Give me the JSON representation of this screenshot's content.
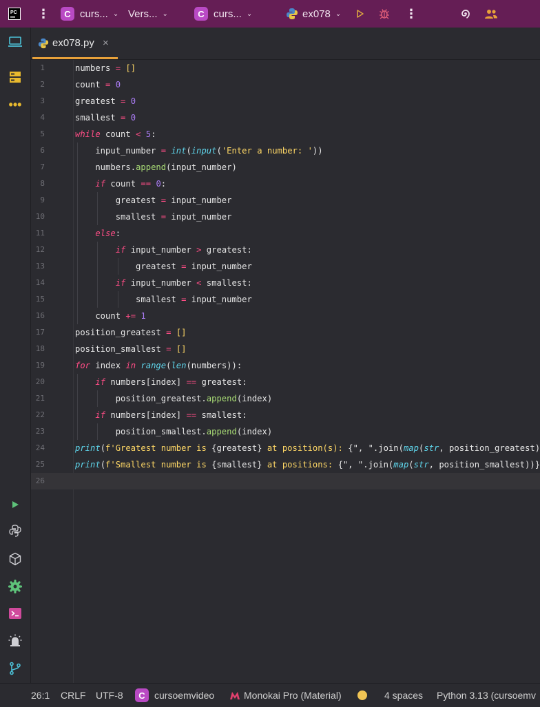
{
  "titlebar": {
    "project1": "curs...",
    "vcs": "Vers...",
    "project2": "curs...",
    "run_config": "ex078"
  },
  "tab": {
    "filename": "ex078.py",
    "close": "×"
  },
  "colors": {
    "titlebar": "#651e55",
    "accent": "#e8a13a",
    "badge": "#b94ac4"
  },
  "editor": {
    "current_line": 26,
    "lines": [
      {
        "n": "1"
      },
      {
        "n": "2"
      },
      {
        "n": "3"
      },
      {
        "n": "4"
      },
      {
        "n": "5"
      },
      {
        "n": "6"
      },
      {
        "n": "7"
      },
      {
        "n": "8"
      },
      {
        "n": "9"
      },
      {
        "n": "10"
      },
      {
        "n": "11"
      },
      {
        "n": "12"
      },
      {
        "n": "13"
      },
      {
        "n": "14"
      },
      {
        "n": "15"
      },
      {
        "n": "16"
      },
      {
        "n": "17"
      },
      {
        "n": "18"
      },
      {
        "n": "19"
      },
      {
        "n": "20"
      },
      {
        "n": "21"
      },
      {
        "n": "22"
      },
      {
        "n": "23"
      },
      {
        "n": "24"
      },
      {
        "n": "25"
      },
      {
        "n": "26"
      }
    ],
    "code": [
      [
        [
          "numbers",
          ""
        ],
        [
          " = ",
          "op"
        ],
        [
          "[]",
          "str"
        ]
      ],
      [
        [
          "count",
          ""
        ],
        [
          " = ",
          "op"
        ],
        [
          "0",
          "num"
        ]
      ],
      [
        [
          "greatest",
          ""
        ],
        [
          " = ",
          "op"
        ],
        [
          "0",
          "num"
        ]
      ],
      [
        [
          "smallest",
          ""
        ],
        [
          " = ",
          "op"
        ],
        [
          "0",
          "num"
        ]
      ],
      [
        [
          "while",
          "kw"
        ],
        [
          " count ",
          ""
        ],
        [
          "<",
          "op"
        ],
        [
          " ",
          ""
        ],
        [
          "5",
          "num"
        ],
        [
          ":",
          ""
        ]
      ],
      [
        [
          "    input_number ",
          ""
        ],
        [
          "=",
          "op"
        ],
        [
          " ",
          ""
        ],
        [
          "int",
          "fn"
        ],
        [
          "(",
          ""
        ],
        [
          "input",
          "fn"
        ],
        [
          "(",
          ""
        ],
        [
          "'Enter a number: '",
          "str"
        ],
        [
          "))",
          ""
        ]
      ],
      [
        [
          "    numbers.",
          ""
        ],
        [
          "append",
          "mth"
        ],
        [
          "(input_number)",
          ""
        ]
      ],
      [
        [
          "    ",
          ""
        ],
        [
          "if",
          "kw"
        ],
        [
          " count ",
          ""
        ],
        [
          "==",
          "op"
        ],
        [
          " ",
          ""
        ],
        [
          "0",
          "num"
        ],
        [
          ":",
          ""
        ]
      ],
      [
        [
          "        greatest ",
          ""
        ],
        [
          "=",
          "op"
        ],
        [
          " input_number",
          ""
        ]
      ],
      [
        [
          "        smallest ",
          ""
        ],
        [
          "=",
          "op"
        ],
        [
          " input_number",
          ""
        ]
      ],
      [
        [
          "    ",
          ""
        ],
        [
          "else",
          "kw"
        ],
        [
          ":",
          ""
        ]
      ],
      [
        [
          "        ",
          ""
        ],
        [
          "if",
          "kw"
        ],
        [
          " input_number ",
          ""
        ],
        [
          ">",
          "op"
        ],
        [
          " greatest:",
          ""
        ]
      ],
      [
        [
          "            greatest ",
          ""
        ],
        [
          "=",
          "op"
        ],
        [
          " input_number",
          ""
        ]
      ],
      [
        [
          "        ",
          ""
        ],
        [
          "if",
          "kw"
        ],
        [
          " input_number ",
          ""
        ],
        [
          "<",
          "op"
        ],
        [
          " smallest:",
          ""
        ]
      ],
      [
        [
          "            smallest ",
          ""
        ],
        [
          "=",
          "op"
        ],
        [
          " input_number",
          ""
        ]
      ],
      [
        [
          "    count ",
          ""
        ],
        [
          "+=",
          "op"
        ],
        [
          " ",
          ""
        ],
        [
          "1",
          "num"
        ]
      ],
      [
        [
          "position_greatest ",
          ""
        ],
        [
          "=",
          "op"
        ],
        [
          " ",
          ""
        ],
        [
          "[]",
          "str"
        ]
      ],
      [
        [
          "position_smallest ",
          ""
        ],
        [
          "=",
          "op"
        ],
        [
          " ",
          ""
        ],
        [
          "[]",
          "str"
        ]
      ],
      [
        [
          "for",
          "kw"
        ],
        [
          " index ",
          ""
        ],
        [
          "in",
          "kw"
        ],
        [
          " ",
          ""
        ],
        [
          "range",
          "fn"
        ],
        [
          "(",
          ""
        ],
        [
          "len",
          "fn"
        ],
        [
          "(numbers)):",
          ""
        ]
      ],
      [
        [
          "    ",
          ""
        ],
        [
          "if",
          "kw"
        ],
        [
          " numbers[index] ",
          ""
        ],
        [
          "==",
          "op"
        ],
        [
          " greatest:",
          ""
        ]
      ],
      [
        [
          "        position_greatest.",
          ""
        ],
        [
          "append",
          "mth"
        ],
        [
          "(index)",
          ""
        ]
      ],
      [
        [
          "    ",
          ""
        ],
        [
          "if",
          "kw"
        ],
        [
          " numbers[index] ",
          ""
        ],
        [
          "==",
          "op"
        ],
        [
          " smallest:",
          ""
        ]
      ],
      [
        [
          "        position_smallest.",
          ""
        ],
        [
          "append",
          "mth"
        ],
        [
          "(index)",
          ""
        ]
      ],
      [
        [
          "print",
          "fn"
        ],
        [
          "(",
          ""
        ],
        [
          "f'Greatest number is ",
          "str"
        ],
        [
          "{greatest}",
          ""
        ],
        [
          " at position(s): ",
          "str"
        ],
        [
          "{\", \".join(",
          ""
        ],
        [
          "map",
          "fn"
        ],
        [
          "(",
          ""
        ],
        [
          "str",
          "fn"
        ],
        [
          ", position_greatest))}",
          ""
        ],
        [
          "')",
          "str"
        ]
      ],
      [
        [
          "print",
          "fn"
        ],
        [
          "(",
          ""
        ],
        [
          "f'Smallest number is ",
          "str"
        ],
        [
          "{smallest}",
          ""
        ],
        [
          " at positions: ",
          "str"
        ],
        [
          "{\", \".join(",
          ""
        ],
        [
          "map",
          "fn"
        ],
        [
          "(",
          ""
        ],
        [
          "str",
          "fn"
        ],
        [
          ", position_smallest))}",
          ""
        ],
        [
          "')",
          "str"
        ]
      ],
      [
        [
          "",
          ""
        ]
      ]
    ]
  },
  "statusbar": {
    "position": "26:1",
    "line_sep": "CRLF",
    "encoding": "UTF-8",
    "project": "cursoemvideo",
    "theme": "Monokai Pro (Material)",
    "indent": "4 spaces",
    "interpreter": "Python 3.13 (cursoemv"
  }
}
